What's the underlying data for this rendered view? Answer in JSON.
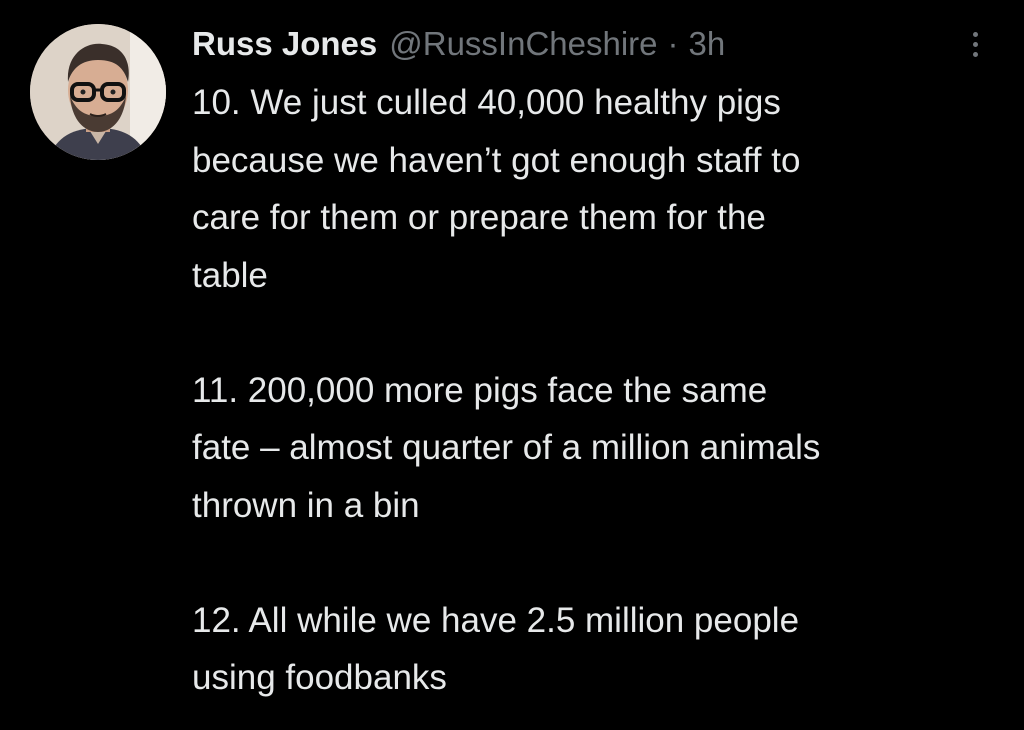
{
  "tweet": {
    "display_name": "Russ Jones",
    "handle": "@RussInCheshire",
    "separator": "·",
    "timestamp": "3h",
    "more_icon": "more-vertical-icon",
    "avatar_icon": "avatar-photo",
    "paragraphs": [
      {
        "lines": [
          "10. We just culled 40,000 healthy pigs",
          "because we haven’t got enough staff to",
          "care for them or prepare them for the",
          "table"
        ]
      },
      {
        "lines": [
          "11. 200,000 more pigs face the same",
          "fate – almost quarter of a million animals",
          "thrown in a bin"
        ]
      },
      {
        "lines": [
          "12. All while we have 2.5 million people",
          "using foodbanks"
        ]
      }
    ]
  },
  "colors": {
    "background": "#000000",
    "primary_text": "#e7e9ea",
    "secondary_text": "#71767b"
  }
}
